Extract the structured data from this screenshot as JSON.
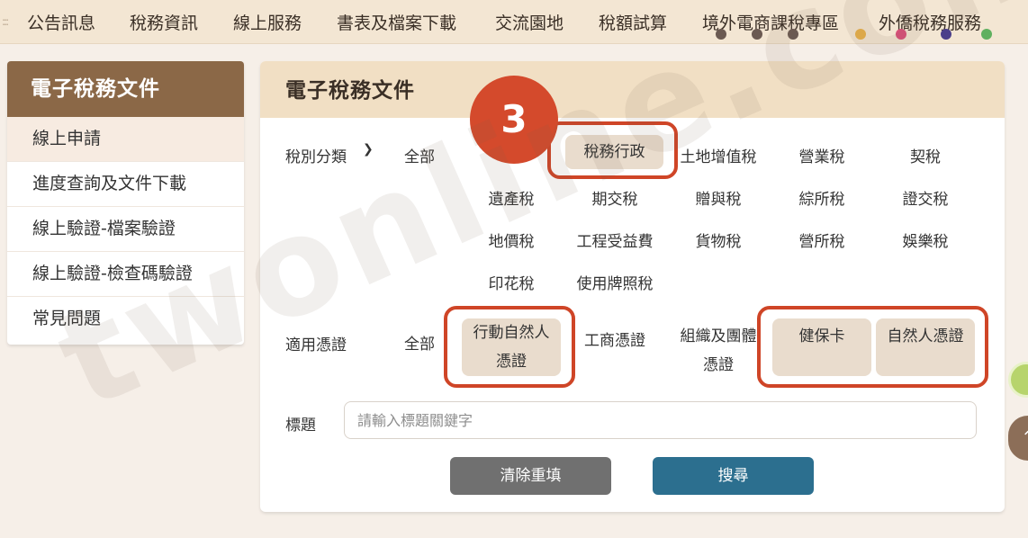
{
  "topnav": {
    "items": [
      "公告訊息",
      "稅務資訊",
      "線上服務",
      "書表及檔案下載",
      "交流園地",
      "稅額試算",
      "境外電商課稅專區",
      "外僑稅務服務"
    ]
  },
  "sidebar": {
    "title": "電子稅務文件",
    "items": [
      "線上申請",
      "進度查詢及文件下載",
      "線上驗證-檔案驗證",
      "線上驗證-檢查碼驗證",
      "常見問題"
    ]
  },
  "panel": {
    "title": "電子稅務文件",
    "tax_category": {
      "label": "稅別分類",
      "all": "全部",
      "options": [
        "稅務行政",
        "土地增值稅",
        "營業稅",
        "契稅",
        "遺產稅",
        "期交稅",
        "贈與稅",
        "綜所稅",
        "證交稅",
        "地價稅",
        "工程受益費",
        "貨物稅",
        "營所稅",
        "娛樂稅",
        "印花稅",
        "使用牌照稅"
      ]
    },
    "credential": {
      "label": "適用憑證",
      "all": "全部",
      "options": [
        "行動自然人\n憑證",
        "工商憑證",
        "組織及團體\n憑證",
        "健保卡",
        "自然人憑證"
      ]
    },
    "title_field": {
      "label": "標題",
      "placeholder": "請輸入標題關鍵字"
    },
    "buttons": {
      "clear": "清除重填",
      "search": "搜尋"
    }
  },
  "annotation": {
    "step_number": "3"
  },
  "watermark": "twonline.com.w",
  "colors": {
    "sidebar_header": "#8b6847",
    "panel_header": "#f1dfc4",
    "selected_chip": "#e9dccd",
    "clear_button": "#707070",
    "search_button": "#2c6f8f",
    "annotation_red": "#cf4527"
  }
}
